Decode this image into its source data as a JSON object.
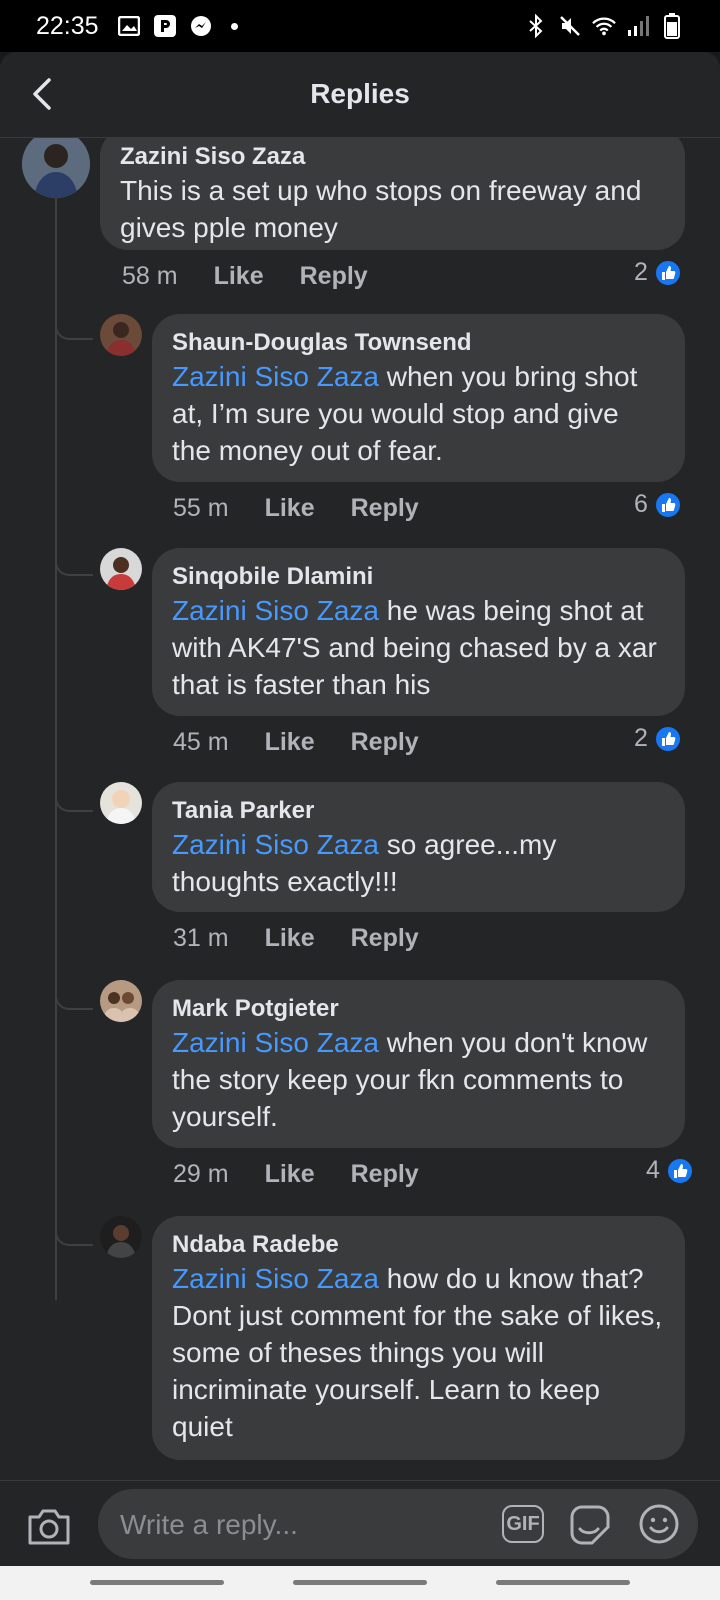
{
  "status_bar": {
    "time": "22:35"
  },
  "header": {
    "title": "Replies"
  },
  "parent_comment": {
    "author": "Zazini Siso Zaza",
    "text": "This is a set up who stops on freeway and gives pple money",
    "time": "58 m",
    "like_label": "Like",
    "reply_label": "Reply",
    "reactions": "2"
  },
  "replies": [
    {
      "author": "Shaun-Douglas Townsend",
      "mention": "Zazini Siso Zaza",
      "text": " when you bring shot at, I’m sure you would stop and give the money out of fear.",
      "time": "55 m",
      "like_label": "Like",
      "reply_label": "Reply",
      "reactions": "6"
    },
    {
      "author": "Sinqobile Dlamini",
      "mention": "Zazini Siso Zaza",
      "text": " he was being shot at with AK47'S and being chased by a xar that is faster than his",
      "time": "45 m",
      "like_label": "Like",
      "reply_label": "Reply",
      "reactions": "2"
    },
    {
      "author": "Tania Parker",
      "mention": "Zazini Siso Zaza",
      "text": " so agree...my thoughts exactly!!!",
      "time": "31 m",
      "like_label": "Like",
      "reply_label": "Reply",
      "reactions": ""
    },
    {
      "author": "Mark Potgieter",
      "mention": "Zazini Siso Zaza",
      "text": " when you don't know the story keep your fkn comments to yourself.",
      "time": "29 m",
      "like_label": "Like",
      "reply_label": "Reply",
      "reactions": "4"
    },
    {
      "author": "Ndaba Radebe",
      "mention": "Zazini Siso Zaza",
      "text": " how do u know that? Dont just comment for the sake of likes, some of theses things you will incriminate yourself. Learn to keep quiet",
      "time": "",
      "like_label": "",
      "reply_label": "",
      "reactions": ""
    }
  ],
  "composer": {
    "placeholder": "Write a reply...",
    "gif_label": "GIF"
  },
  "icons": {
    "back": "chevron-left-icon",
    "camera": "camera-icon",
    "gif": "gif-icon",
    "sticker": "sticker-icon",
    "emoji": "emoji-icon",
    "like_badge": "thumbs-up-icon"
  },
  "colors": {
    "background": "#242526",
    "bubble": "#3a3b3c",
    "mention": "#4599ff",
    "like_badge": "#1877f2",
    "muted_text": "#b0b3b8"
  }
}
